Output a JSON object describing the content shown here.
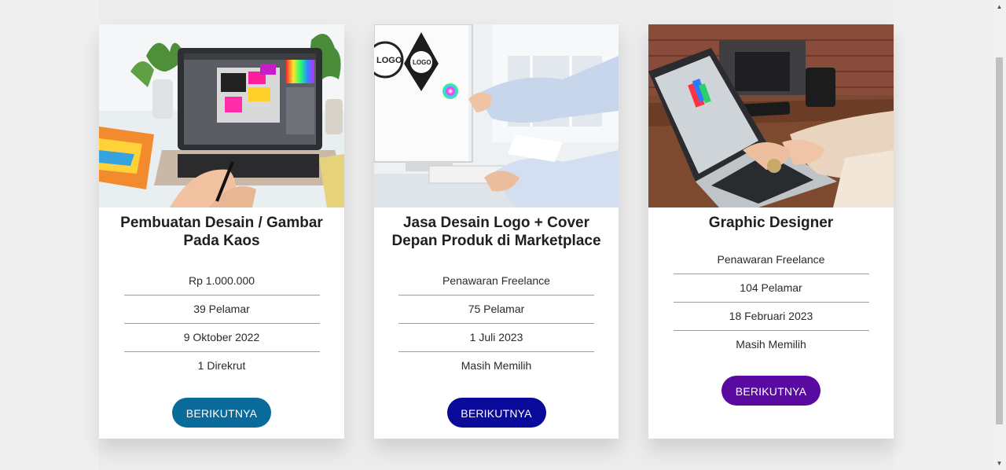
{
  "cards": [
    {
      "title": "Pembuatan Desain / Gambar Pada Kaos",
      "details": [
        "Rp 1.000.000",
        "39 Pelamar",
        "9 Oktober 2022",
        "1 Direkrut"
      ],
      "button_label": "BERIKUTNYA",
      "button_color": "#0a6a9a",
      "image_icon": "laptop-design-photo"
    },
    {
      "title": "Jasa Desain Logo + Cover Depan Produk di Marketplace",
      "details": [
        "Penawaran Freelance",
        "75 Pelamar",
        "1 Juli 2023",
        "Masih Memilih"
      ],
      "button_label": "BERIKUTNYA",
      "button_color": "#0a0a9a",
      "image_icon": "logo-design-photo",
      "image_logo_text": "LOGO"
    },
    {
      "title": "Graphic Designer",
      "details": [
        "Penawaran Freelance",
        "104 Pelamar",
        "18 Februari 2023",
        "Masih Memilih"
      ],
      "button_label": "BERIKUTNYA",
      "button_color": "#5a0aa0",
      "image_icon": "laptop-typing-photo"
    }
  ],
  "scrollbar": {
    "up_icon": "▲",
    "down_icon": "▼"
  }
}
